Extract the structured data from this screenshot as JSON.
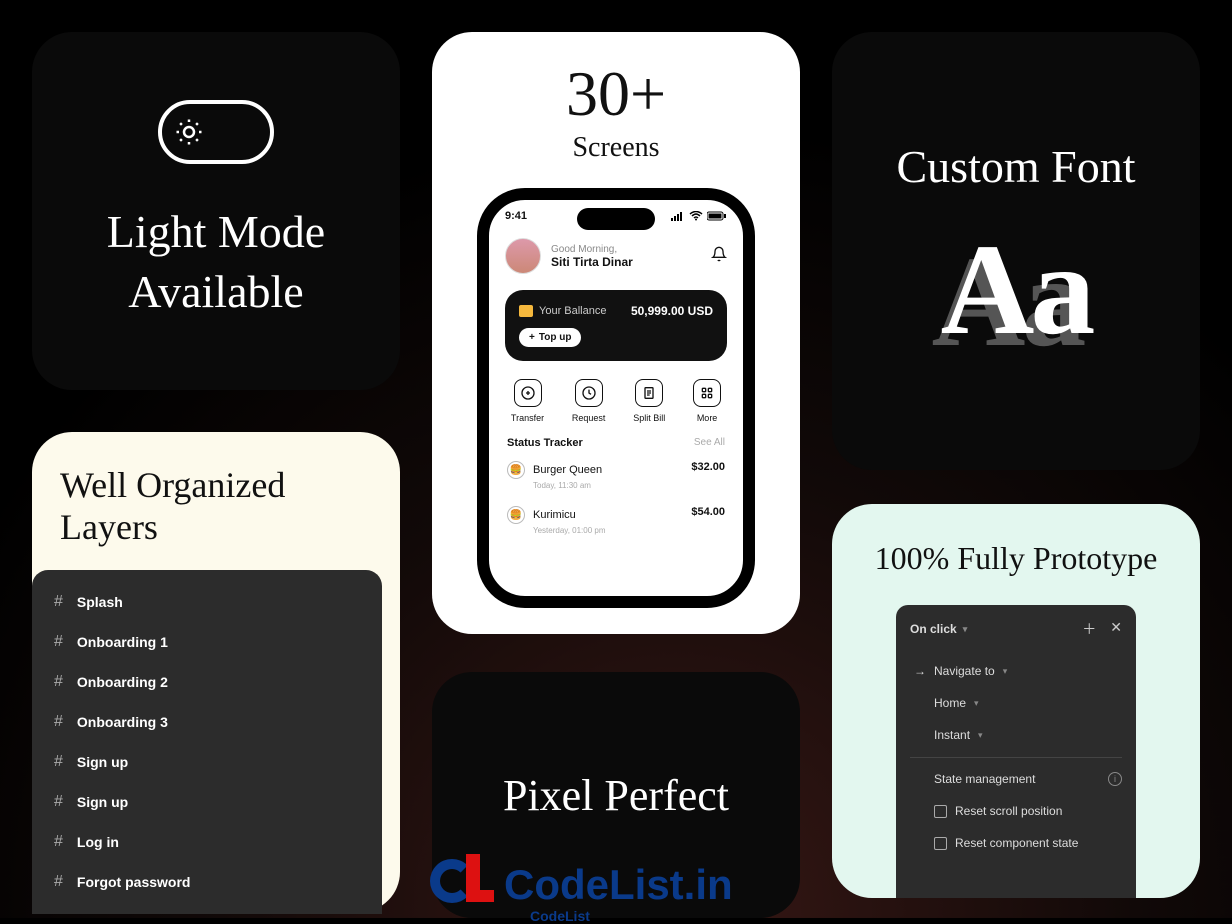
{
  "light": {
    "title": "Light Mode Available"
  },
  "font": {
    "title": "Custom Font",
    "sample": "Aa"
  },
  "layers": {
    "title": "Well Organized Layers",
    "items": [
      "Splash",
      "Onboarding 1",
      "Onboarding 2",
      "Onboarding 3",
      "Sign up",
      "Sign up",
      "Log in",
      "Forgot password"
    ]
  },
  "screens": {
    "count": "30+",
    "sub": "Screens",
    "phone": {
      "time": "9:41",
      "greeting": "Good Morning,",
      "username": "Siti Tirta Dinar",
      "balance_label": "Your Ballance",
      "balance_amount": "50,999.00 USD",
      "topup": "Top up",
      "actions": [
        {
          "label": "Transfer"
        },
        {
          "label": "Request"
        },
        {
          "label": "Split Bill"
        },
        {
          "label": "More"
        }
      ],
      "tracker_title": "Status Tracker",
      "see_all": "See All",
      "transactions": [
        {
          "name": "Burger Queen",
          "amount": "$32.00",
          "time": "Today, 11:30 am"
        },
        {
          "name": "Kurimicu",
          "amount": "$54.00",
          "time": "Yesterday, 01:00 pm"
        }
      ]
    }
  },
  "pixel": {
    "title": "Pixel Perfect"
  },
  "proto": {
    "title": "100% Fully Prototype",
    "trigger": "On click",
    "action": "Navigate to",
    "destination": "Home",
    "animation": "Instant",
    "state_mgmt": "State management",
    "reset_scroll": "Reset scroll position",
    "reset_state": "Reset component state"
  },
  "watermark": {
    "text": "CodeList.in",
    "sub": "CodeList"
  }
}
